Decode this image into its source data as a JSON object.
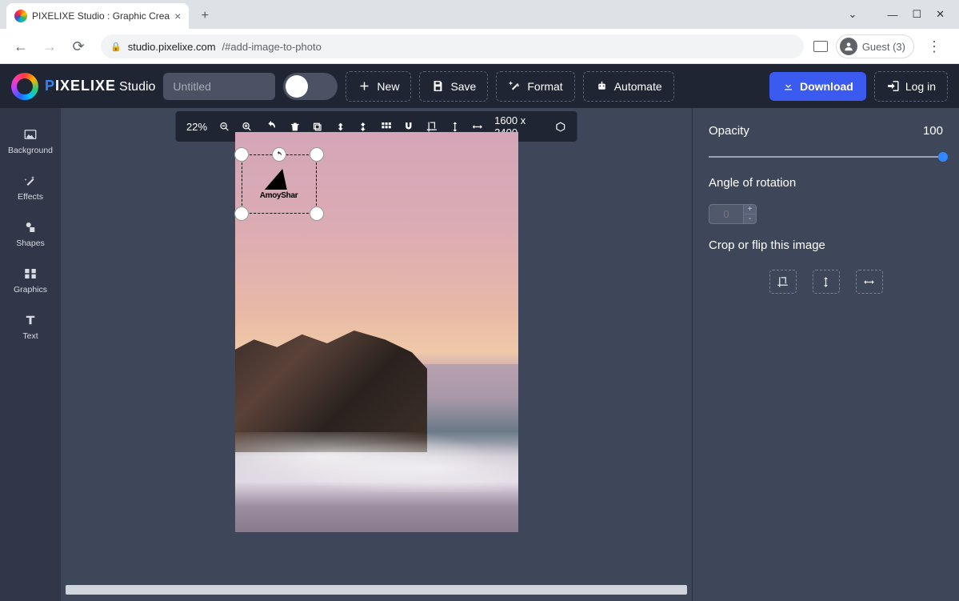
{
  "browser": {
    "tab_title": "PIXELIXE Studio : Graphic Crea",
    "url_host": "studio.pixelixe.com",
    "url_hash": "/#add-image-to-photo",
    "guest_label": "Guest (3)"
  },
  "app": {
    "logo_main": "PIXELIXE",
    "logo_sub": "Studio",
    "title_placeholder": "Untitled",
    "header_buttons": {
      "new": "New",
      "save": "Save",
      "format": "Format",
      "automate": "Automate",
      "download": "Download",
      "login": "Log in"
    }
  },
  "sidebar": {
    "background": "Background",
    "effects": "Effects",
    "shapes": "Shapes",
    "graphics": "Graphics",
    "text": "Text"
  },
  "toolbar": {
    "zoom": "22%",
    "dimensions": "1600 x 2400"
  },
  "overlay": {
    "label": "AmoyShar"
  },
  "panel": {
    "opacity_label": "Opacity",
    "opacity_value": "100",
    "rotation_label": "Angle of rotation",
    "rotation_placeholder": "0",
    "crop_label": "Crop or flip this image"
  }
}
